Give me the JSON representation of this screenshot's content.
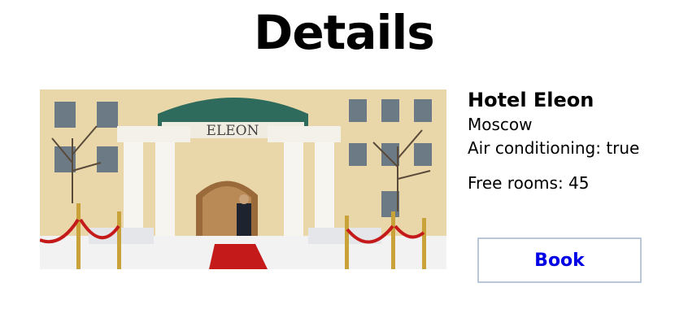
{
  "page": {
    "title": "Details"
  },
  "hotel": {
    "photo_sign": "ELEON",
    "name": "Hotel Eleon",
    "city": "Moscow",
    "air_conditioning": "Air conditioning: true",
    "free_rooms": "Free rooms: 45"
  },
  "actions": {
    "book_label": "Book"
  },
  "colors": {
    "button_text": "#0000e6",
    "button_border": "#b9c7d9",
    "canopy": "#2e6b5c",
    "carpet": "#c41a1a"
  }
}
